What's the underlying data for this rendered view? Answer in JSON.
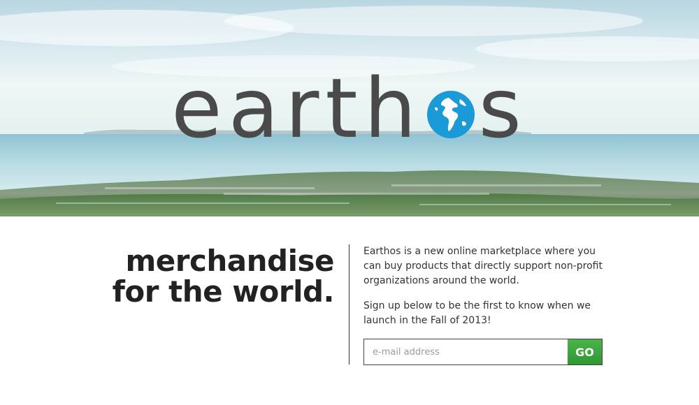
{
  "hero": {
    "logo": {
      "text_before": "earth",
      "text_after": "s",
      "globe_icon": "globe-icon",
      "globe_color": "#1a9ad6",
      "text_color": "#4a4a4a"
    },
    "background": "coastal-landscape-photo"
  },
  "main": {
    "tagline_line1": "merchandise",
    "tagline_line2": "for the world.",
    "description": "Earthos is a new online marketplace where you can buy products that directly support non-profit organizations around the world.",
    "signup_prompt": "Sign up below to be the first to know when we launch in the Fall of 2013!"
  },
  "signup": {
    "email_placeholder": "e-mail address",
    "email_value": "",
    "button_label": "GO",
    "button_color": "#3aa43d"
  }
}
